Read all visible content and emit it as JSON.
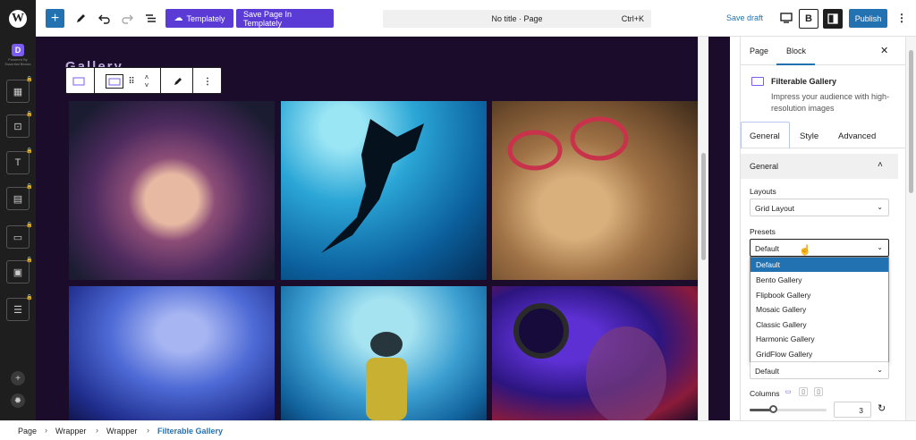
{
  "topbar": {
    "add_icon": "+",
    "templately_label": "Templately",
    "save_templately_label": "Save Page In Templately",
    "command_bar_title": "No title · Page",
    "command_bar_shortcut": "Ctrl+K",
    "save_draft_label": "Save draft",
    "publish_label": "Publish",
    "accent": "#2271b1",
    "purple": "#5b3bd6"
  },
  "rail": {
    "brand_caption": "Powered By Essential Blocks",
    "icons": [
      "gallery-icon",
      "focus-icon",
      "text-icon",
      "toolbar-icon",
      "form-icon",
      "image-icon",
      "list-icon"
    ],
    "bottom_icons": [
      "plus-icon",
      "settings-icon"
    ]
  },
  "canvas": {
    "gallery_title": "Gallery",
    "background": "#1a0c2a"
  },
  "sidebar": {
    "tabs": [
      "Page",
      "Block"
    ],
    "active_tab": "Block",
    "block_name": "Filterable Gallery",
    "block_description": "Impress your audience with high-resolution images",
    "inspector_tabs": [
      "General",
      "Style",
      "Advanced"
    ],
    "panel_title": "General",
    "layouts_label": "Layouts",
    "layouts_value": "Grid Layout",
    "presets_label": "Presets",
    "presets_value": "Default",
    "preset_options": [
      "Default",
      "Bento Gallery",
      "Flipbook Gallery",
      "Mosaic Gallery",
      "Classic Gallery",
      "Harmonic Gallery",
      "GridFlow Gallery"
    ],
    "selected_preset": "Default",
    "second_select_value": "Default",
    "columns_label": "Columns",
    "columns_value": "3",
    "columns_slider_fraction": 0.3
  },
  "footer": {
    "breadcrumbs": [
      "Page",
      "Wrapper",
      "Wrapper",
      "Filterable Gallery"
    ]
  }
}
